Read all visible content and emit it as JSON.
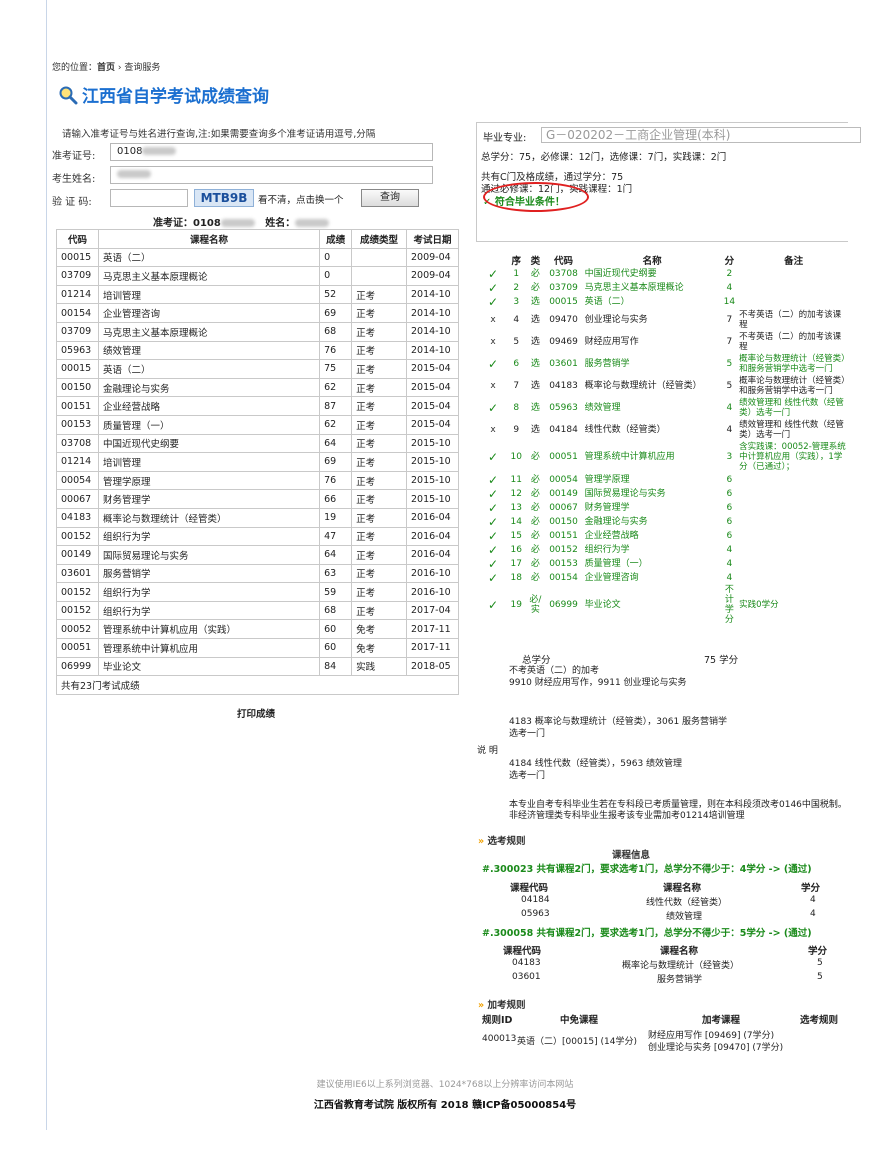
{
  "breadcrumb": {
    "prefix": "您的位置：",
    "home": "首页",
    "sep": "›",
    "current": "查询服务"
  },
  "page_title": "江西省自学考试成绩查询",
  "hint": "请输入准考证号与姓名进行查询,注:如果需要查询多个准考证请用逗号,分隔",
  "form": {
    "exam_no_label": "准考证号:",
    "exam_no_value": "0108",
    "name_label": "考生姓名:",
    "captcha_label": "验 证 码:",
    "captcha_text": "MTB9B",
    "captcha_hint": "看不清，点击换一个",
    "query_button": "查询"
  },
  "result_header": {
    "exam_no_label": "准考证：0108",
    "name_label": "姓名："
  },
  "grades": {
    "columns": [
      "代码",
      "课程名称",
      "成绩",
      "成绩类型",
      "考试日期"
    ],
    "rows": [
      [
        "00015",
        "英语（二）",
        "0",
        "",
        "2009-04"
      ],
      [
        "03709",
        "马克思主义基本原理概论",
        "0",
        "",
        "2009-04"
      ],
      [
        "01214",
        "培训管理",
        "52",
        "正考",
        "2014-10"
      ],
      [
        "00154",
        "企业管理咨询",
        "69",
        "正考",
        "2014-10"
      ],
      [
        "03709",
        "马克思主义基本原理概论",
        "68",
        "正考",
        "2014-10"
      ],
      [
        "05963",
        "绩效管理",
        "76",
        "正考",
        "2014-10"
      ],
      [
        "00015",
        "英语（二）",
        "75",
        "正考",
        "2015-04"
      ],
      [
        "00150",
        "金融理论与实务",
        "62",
        "正考",
        "2015-04"
      ],
      [
        "00151",
        "企业经营战略",
        "87",
        "正考",
        "2015-04"
      ],
      [
        "00153",
        "质量管理（一）",
        "62",
        "正考",
        "2015-04"
      ],
      [
        "03708",
        "中国近现代史纲要",
        "64",
        "正考",
        "2015-10"
      ],
      [
        "01214",
        "培训管理",
        "69",
        "正考",
        "2015-10"
      ],
      [
        "00054",
        "管理学原理",
        "76",
        "正考",
        "2015-10"
      ],
      [
        "00067",
        "财务管理学",
        "66",
        "正考",
        "2015-10"
      ],
      [
        "04183",
        "概率论与数理统计（经管类）",
        "19",
        "正考",
        "2016-04"
      ],
      [
        "00152",
        "组织行为学",
        "47",
        "正考",
        "2016-04"
      ],
      [
        "00149",
        "国际贸易理论与实务",
        "64",
        "正考",
        "2016-04"
      ],
      [
        "03601",
        "服务营销学",
        "63",
        "正考",
        "2016-10"
      ],
      [
        "00152",
        "组织行为学",
        "59",
        "正考",
        "2016-10"
      ],
      [
        "00152",
        "组织行为学",
        "68",
        "正考",
        "2017-04"
      ],
      [
        "00052",
        "管理系统中计算机应用（实践）",
        "60",
        "免考",
        "2017-11"
      ],
      [
        "00051",
        "管理系统中计算机应用",
        "60",
        "免考",
        "2017-11"
      ],
      [
        "06999",
        "毕业论文",
        "84",
        "实践",
        "2018-05"
      ]
    ],
    "footer": "共有23门考试成绩"
  },
  "print_link": "打印成绩",
  "major": {
    "label": "毕业专业:",
    "value": "G－020202－工商企业管理(本科)",
    "summary": "总学分：75，必修课：12门，选修课：7门，实践课：2门",
    "passed": "共有C门及格成绩，通过学分：75",
    "passed_req": "通过必修课：12门，实践课程：1门",
    "status": "符合毕业条件！"
  },
  "requirements": {
    "columns": [
      "序",
      "类",
      "代码",
      "名称",
      "分",
      "备注"
    ],
    "rows": [
      {
        "ok": true,
        "n": "1",
        "t": "必",
        "code": "03708",
        "name": "中国近现代史纲要",
        "cr": "2",
        "note": ""
      },
      {
        "ok": true,
        "n": "2",
        "t": "必",
        "code": "03709",
        "name": "马克思主义基本原理概论",
        "cr": "4",
        "note": ""
      },
      {
        "ok": true,
        "n": "3",
        "t": "选",
        "code": "00015",
        "name": "英语（二）",
        "cr": "14",
        "note": ""
      },
      {
        "ok": false,
        "n": "4",
        "t": "选",
        "code": "09470",
        "name": "创业理论与实务",
        "cr": "7",
        "note": "不考英语（二）的加考该课程"
      },
      {
        "ok": false,
        "n": "5",
        "t": "选",
        "code": "09469",
        "name": "财经应用写作",
        "cr": "7",
        "note": "不考英语（二）的加考该课程"
      },
      {
        "ok": true,
        "n": "6",
        "t": "选",
        "code": "03601",
        "name": "服务营销学",
        "cr": "5",
        "note": "概率论与数理统计（经管类）和服务营销学中选考一门"
      },
      {
        "ok": false,
        "n": "7",
        "t": "选",
        "code": "04183",
        "name": "概率论与数理统计（经管类）",
        "cr": "5",
        "note": "概率论与数理统计（经管类）和服务营销学中选考一门"
      },
      {
        "ok": true,
        "n": "8",
        "t": "选",
        "code": "05963",
        "name": "绩效管理",
        "cr": "4",
        "note": "绩效管理和 线性代数（经管类）选考一门"
      },
      {
        "ok": false,
        "n": "9",
        "t": "选",
        "code": "04184",
        "name": "线性代数（经管类）",
        "cr": "4",
        "note": "绩效管理和 线性代数（经管类）选考一门"
      },
      {
        "ok": true,
        "n": "10",
        "t": "必",
        "code": "00051",
        "name": "管理系统中计算机应用",
        "cr": "3",
        "note": "含实践课：00052-管理系统中计算机应用（实践），1学分（已通过）；"
      },
      {
        "ok": true,
        "n": "11",
        "t": "必",
        "code": "00054",
        "name": "管理学原理",
        "cr": "6",
        "note": ""
      },
      {
        "ok": true,
        "n": "12",
        "t": "必",
        "code": "00149",
        "name": "国际贸易理论与实务",
        "cr": "6",
        "note": ""
      },
      {
        "ok": true,
        "n": "13",
        "t": "必",
        "code": "00067",
        "name": "财务管理学",
        "cr": "6",
        "note": ""
      },
      {
        "ok": true,
        "n": "14",
        "t": "必",
        "code": "00150",
        "name": "金融理论与实务",
        "cr": "6",
        "note": ""
      },
      {
        "ok": true,
        "n": "15",
        "t": "必",
        "code": "00151",
        "name": "企业经营战略",
        "cr": "6",
        "note": ""
      },
      {
        "ok": true,
        "n": "16",
        "t": "必",
        "code": "00152",
        "name": "组织行为学",
        "cr": "4",
        "note": ""
      },
      {
        "ok": true,
        "n": "17",
        "t": "必",
        "code": "00153",
        "name": "质量管理（一）",
        "cr": "4",
        "note": ""
      },
      {
        "ok": true,
        "n": "18",
        "t": "必",
        "code": "00154",
        "name": "企业管理咨询",
        "cr": "4",
        "note": ""
      },
      {
        "ok": true,
        "n": "19",
        "t": "必/实",
        "code": "06999",
        "name": "毕业论文",
        "cr": "不计学分",
        "note": "实践0学分"
      }
    ],
    "total_label": "总学分",
    "total_value": "75 学分"
  },
  "explain": {
    "label": "说 明",
    "para1": "不考英语（二）的加考\n9910 财经应用写作，9911 创业理论与实务",
    "para2": "4183 概率论与数理统计（经管类），3061 服务营销学\n选考一门",
    "para3": "4184 线性代数（经管类），5963 绩效管理\n选考一门",
    "para4": "本专业自考专科毕业生若在专科段已考质量管理，则在本科段须改考0146中国税制。\n非经济管理类专科毕业生报考该专业需加考01214培训管理"
  },
  "elective_rules": {
    "title": "选考规则",
    "info_title": "课程信息",
    "groups": [
      {
        "header": "#.300023 共有课程2门，要求选考1门，总学分不得少于：4学分 -> (通过)",
        "columns": [
          "课程代码",
          "课程名称",
          "学分"
        ],
        "rows": [
          [
            "04184",
            "线性代数（经管类）",
            "4"
          ],
          [
            "05963",
            "绩效管理",
            "4"
          ]
        ]
      },
      {
        "header": "#.300058 共有课程2门，要求选考1门，总学分不得少于：5学分 -> (通过)",
        "columns": [
          "课程代码",
          "课程名称",
          "学分"
        ],
        "rows": [
          [
            "04183",
            "概率论与数理统计（经管类）",
            "5"
          ],
          [
            "03601",
            "服务营销学",
            "5"
          ]
        ]
      }
    ]
  },
  "extra_rules": {
    "title": "加考规则",
    "columns": [
      "规则ID",
      "中免课程",
      "加考课程",
      "选考规则"
    ],
    "row": {
      "id": "400013",
      "exempt": "英语（二）[00015]  (14学分)",
      "extra1": "财经应用写作 [09469]  (7学分)",
      "extra2": "创业理论与实务 [09470]  (7学分)"
    }
  },
  "footer": {
    "line1": "建议使用IE6以上系列浏览器、1024*768以上分辨率访问本网站",
    "line2": "江西省教育考试院  版权所有  2018  赣ICP备05000854号"
  }
}
